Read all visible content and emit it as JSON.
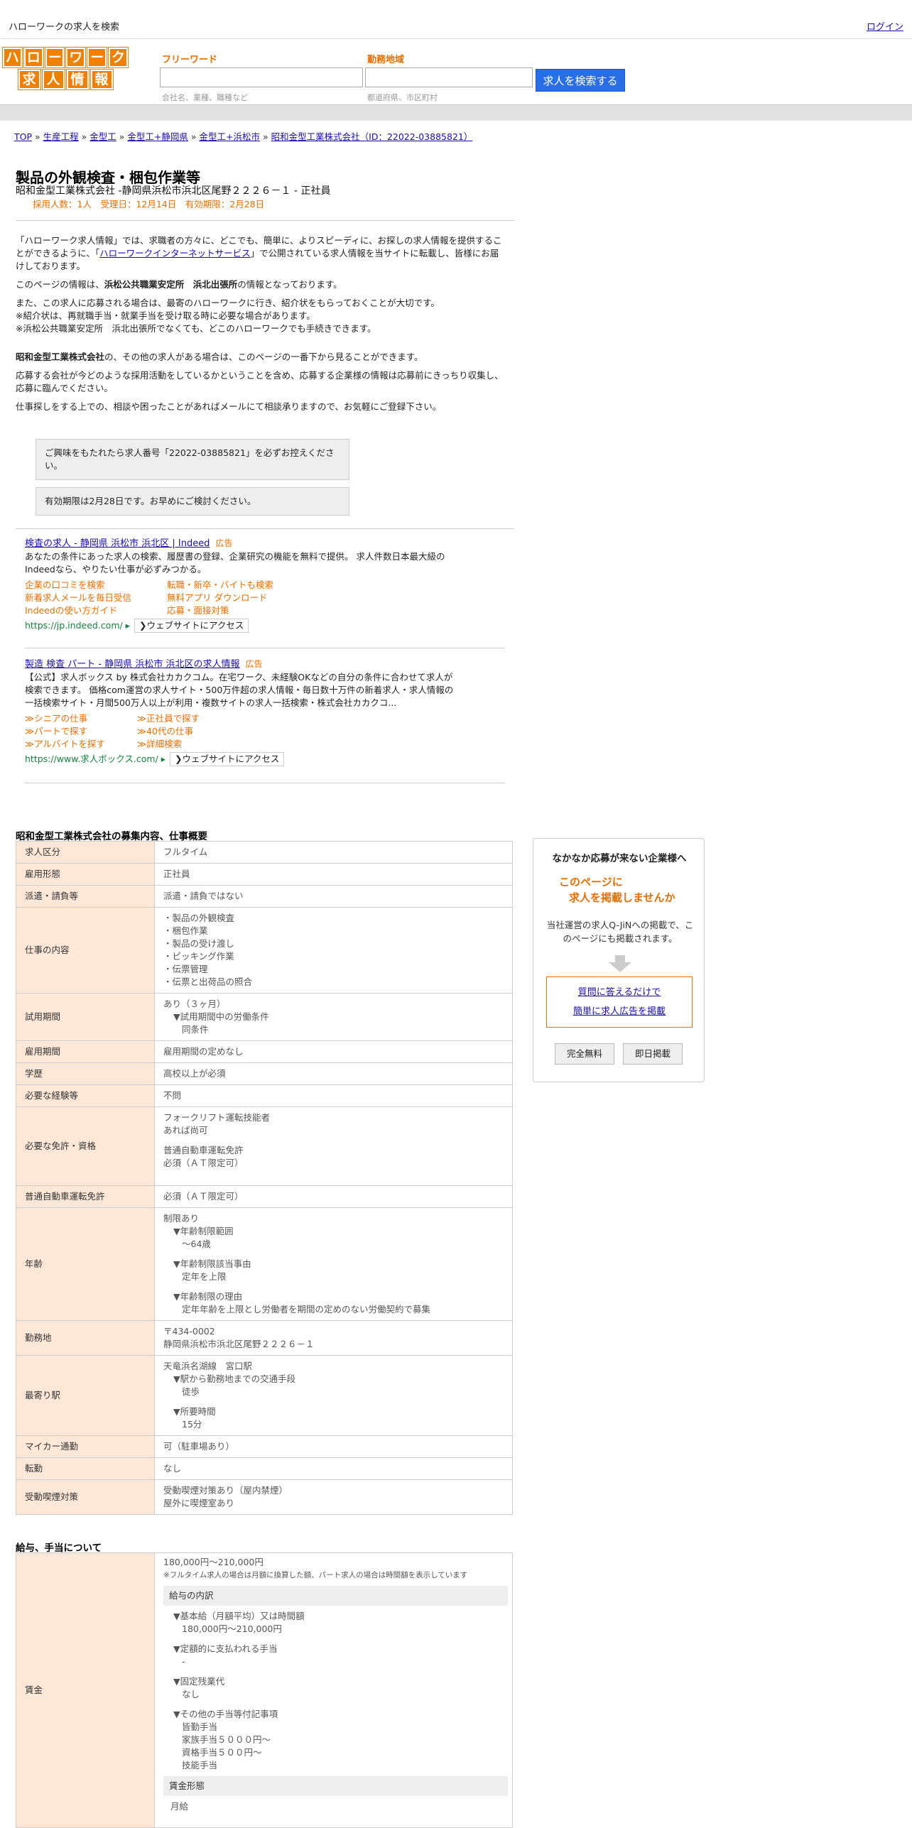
{
  "topbar": {
    "site_title": "ハローワークの求人を検索",
    "login": "ログイン"
  },
  "logo": {
    "row1": [
      "ハ",
      "ロ",
      "ー",
      "ワ",
      "ー",
      "ク"
    ],
    "row2": [
      "求",
      "人",
      "情",
      "報"
    ]
  },
  "search": {
    "keyword_label": "フリーワード",
    "keyword_hint": "会社名、業種、職種など",
    "area_label": "勤務地域",
    "area_hint": "都道府県、市区町村",
    "button": "求人を検索する"
  },
  "breadcrumb": [
    "TOP",
    "生産工程",
    "金型工",
    "金型工+静岡県",
    "金型工+浜松市",
    "昭和金型工業株式会社（ID：22022-03885821）"
  ],
  "breadcrumb_sep": "»",
  "job": {
    "title": "製品の外観検査・梱包作業等",
    "company_line": "昭和金型工業株式会社 -静岡県浜松市浜北区尾野２２２６－１ - 正社員",
    "meta": "採用人数：1人　受理日：12月14日　有効期限：2月28日"
  },
  "intro": {
    "p1a": "「ハローワーク求人情報」では、求職者の方々に、どこでも、簡単に、よりスピーディに、お探しの求人情報を提供することができるように、「",
    "p1link": "ハローワークインターネットサービス",
    "p1b": "」で公開されている求人情報を当サイトに転載し、皆様にお届けしております。",
    "p2a": "このページの情報は、",
    "p2b": "浜松公共職業安定所　浜北出張所",
    "p2c": "の情報となっております。",
    "p3": "また、この求人に応募される場合は、最寄のハローワークに行き、紹介状をもらっておくことが大切です。",
    "p3b": "※紹介状は、再就職手当・就業手当を受け取る時に必要な場合があります。",
    "p3c": "※浜松公共職業安定所　浜北出張所でなくても、どこのハローワークでも手続きできます。",
    "p4a": "昭和金型工業株式会社",
    "p4b": "の、その他の求人がある場合は、このページの一番下から見ることができます。",
    "p5": "応募する会社が今どのような採用活動をしているかということを含め、応募する企業様の情報は応募前にきっちり収集し、応募に臨んでください。",
    "p6": "仕事探しをする上での、相談や困ったことがあればメールにて相談承りますので、お気軽にご登録下さい。"
  },
  "notices": [
    "ご興味をもたれたら求人番号「22022-03885821」を必ずお控えください。",
    "有効期限は2月28日です。お早めにご検討ください。"
  ],
  "ads": [
    {
      "title": "検査の求人 - 静岡県 浜松市 浜北区 | Indeed",
      "badge": "広告",
      "desc": "あなたの条件にあった求人の検索、履歴書の登録、企業研究の機能を無料で提供。 求人件数日本最大級のIndeedなら、やりたい仕事が必ずみつかる。",
      "links": [
        "企業の口コミを検索",
        "転職・新卒・バイトも検索",
        "新着求人メールを毎日受信",
        "無料アプリ ダウンロード",
        "Indeedの使い方ガイド",
        "応募・面接対策"
      ],
      "url": "https://jp.indeed.com/ ▸",
      "button": "❯ウェブサイトにアクセス"
    },
    {
      "title": "製造 検査 パート - 静岡県 浜松市 浜北区の求人情報",
      "badge": "広告",
      "desc": "【公式】求人ボックス by 株式会社カカクコム。在宅ワーク、未経験OKなどの自分の条件に合わせて求人が検索できます。 価格com運営の求人サイト・500万件超の求人情報・毎日数十万件の新着求人・求人情報の一括検索サイト・月間500万人以上が利用・複数サイトの求人一括検索・株式会社カカクコ...",
      "links": [
        "≫シニアの仕事",
        "≫正社員で探す",
        "≫パートで探す",
        "≫40代の仕事",
        "≫アルバイトを探す",
        "≫詳細検索"
      ],
      "url": "https://www.求人ボックス.com/ ▸",
      "button": "❯ウェブサイトにアクセス"
    }
  ],
  "summary_title": "昭和金型工業株式会社の募集内容、仕事概要",
  "summary": {
    "r1": {
      "k": "求人区分",
      "v": "フルタイム"
    },
    "r2": {
      "k": "雇用形態",
      "v": "正社員"
    },
    "r3": {
      "k": "派遣・請負等",
      "v": "派遣・請負ではない"
    },
    "r4": {
      "k": "仕事の内容",
      "v1": "・製品の外観検査",
      "v2": "・梱包作業",
      "v3": "・製品の受け渡し",
      "v4": "・ピッキング作業",
      "v5": "・伝票管理",
      "v6": "・伝票と出荷品の照合"
    },
    "r5": {
      "k": "試用期間",
      "v1": "あり（３ヶ月）",
      "v2": "▼試用期間中の労働条件",
      "v3": "同条件"
    },
    "r6": {
      "k": "雇用期間",
      "v": "雇用期間の定めなし"
    },
    "r7": {
      "k": "学歴",
      "v": "高校以上が必須"
    },
    "r8": {
      "k": "必要な経験等",
      "v": "不問"
    },
    "r9": {
      "k": "必要な免許・資格",
      "v1": "フォークリフト運転技能者",
      "v2": "あれば尚可",
      "v3": "普通自動車運転免許",
      "v4": "必須（ＡＴ限定可）"
    },
    "r10": {
      "k": "普通自動車運転免許",
      "v": "必須（ＡＴ限定可）"
    },
    "r11": {
      "k": "年齢",
      "v1": "制限あり",
      "v2": "▼年齢制限範囲",
      "v3": "〜64歳",
      "v4": "▼年齢制限該当事由",
      "v5": "定年を上限",
      "v6": "▼年齢制限の理由",
      "v7": "定年年齢を上限とし労働者を期間の定めのない労働契約で募集"
    },
    "r12": {
      "k": "勤務地",
      "v1": "〒434-0002",
      "v2": "静岡県浜松市浜北区尾野２２２６－１"
    },
    "r13": {
      "k": "最寄り駅",
      "v1": "天竜浜名湖線　宮口駅",
      "v2": "▼駅から勤務地までの交通手段",
      "v3": "徒歩",
      "v4": "▼所要時間",
      "v5": "15分"
    },
    "r14": {
      "k": "マイカー通勤",
      "v": "可（駐車場あり）"
    },
    "r15": {
      "k": "転勤",
      "v": "なし"
    },
    "r16": {
      "k": "受動喫煙対策",
      "v1": "受動喫煙対策あり（屋内禁煙）",
      "v2": "屋外に喫煙室あり"
    }
  },
  "salary_title": "給与、手当について",
  "salary": {
    "k": "賃金",
    "range": "180,000円〜210,000円",
    "note": "※フルタイム求人の場合は月額に換算した額、パート求人の場合は時間額を表示しています",
    "breakdown_head": "給与の内訳",
    "b1": "▼基本給（月額平均）又は時間額",
    "b1v": "180,000円〜210,000円",
    "b2": "▼定額的に支払われる手当",
    "b2v": "-",
    "b3": "▼固定残業代",
    "b3v": "なし",
    "b4": "▼その他の手当等付記事項",
    "b4v1": "皆勤手当",
    "b4v2": "家族手当５０００円～",
    "b4v3": "資格手当５００円～",
    "b4v4": "技能手当",
    "form_head": "賃金形態",
    "form_v": "月給"
  },
  "side": {
    "title": "なかなか応募が来ない企業様へ",
    "catch1": "このページに",
    "catch2": "求人を掲載しませんか",
    "desc": "当社運営の求人Q-JiNへの掲載で、このページにも掲載されます。",
    "link1": "質問に答えるだけで",
    "link2": "簡単に求人広告を掲載",
    "btn1": "完全無料",
    "btn2": "即日掲載"
  }
}
